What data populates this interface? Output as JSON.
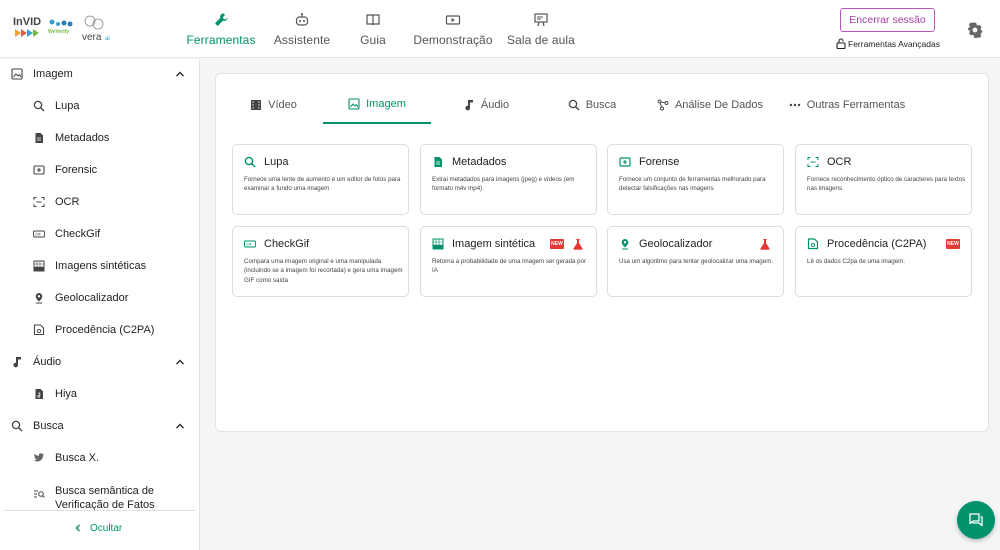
{
  "brand": {
    "invid": "InVID",
    "wevarify": "WeVerify",
    "vera": "vera",
    "vera_ai": "ai"
  },
  "nav": {
    "items": [
      {
        "label": "Ferramentas",
        "icon": "wrench-icon",
        "active": true
      },
      {
        "label": "Assistente",
        "icon": "robot-icon",
        "active": false
      },
      {
        "label": "Guia",
        "icon": "book-icon",
        "active": false
      },
      {
        "label": "Demonstração",
        "icon": "video-icon",
        "active": false
      },
      {
        "label": "Sala de aula",
        "icon": "classroom-icon",
        "active": false
      }
    ]
  },
  "header": {
    "logout_label": "Encerrar sessão",
    "advanced_label": "Ferramentas Avançadas"
  },
  "sidebar": {
    "items": [
      {
        "label": "Imagem",
        "icon": "image-icon",
        "type": "section",
        "expanded": true
      },
      {
        "label": "Lupa",
        "icon": "search-icon",
        "type": "item"
      },
      {
        "label": "Metadados",
        "icon": "document-icon",
        "type": "item"
      },
      {
        "label": "Forensic",
        "icon": "forensic-icon",
        "type": "item"
      },
      {
        "label": "OCR",
        "icon": "ocr-icon",
        "type": "item"
      },
      {
        "label": "CheckGif",
        "icon": "gif-icon",
        "type": "item"
      },
      {
        "label": "Imagens sintéticas",
        "icon": "synthetic-image-icon",
        "type": "item"
      },
      {
        "label": "Geolocalizador",
        "icon": "location-pin-icon",
        "type": "item"
      },
      {
        "label": "Procedência (C2PA)",
        "icon": "provenance-icon",
        "type": "item"
      },
      {
        "label": "Áudio",
        "icon": "music-note-icon",
        "type": "section",
        "expanded": true
      },
      {
        "label": "Hiya",
        "icon": "audio-file-icon",
        "type": "item"
      },
      {
        "label": "Busca",
        "icon": "search-icon",
        "type": "section",
        "expanded": true
      },
      {
        "label": "Busca X.",
        "icon": "x-logo-icon",
        "type": "item"
      },
      {
        "label": "Busca semântica de",
        "label2": "Verificação de Fatos",
        "icon": "semantic-search-icon",
        "type": "item"
      }
    ],
    "collapse_label": "Ocultar"
  },
  "tabs": [
    {
      "label": "Vídeo",
      "icon": "film-icon",
      "active": false
    },
    {
      "label": "Imagem",
      "icon": "image-icon",
      "active": true
    },
    {
      "label": "Áudio",
      "icon": "music-note-icon",
      "active": false
    },
    {
      "label": "Busca",
      "icon": "search-icon",
      "active": false
    },
    {
      "label": "Análise De Dados",
      "icon": "data-analysis-icon",
      "active": false
    },
    {
      "label": "Outras Ferramentas",
      "icon": "more-icon",
      "active": false
    }
  ],
  "tools": [
    {
      "title": "Lupa",
      "icon": "search-icon",
      "desc": "Fornece uma lente de aumento e um editor de fotos para examinar a fundo uma imagem",
      "new": false,
      "lab": false
    },
    {
      "title": "Metadados",
      "icon": "document-icon",
      "desc": "Extrai metadados para imagens (jpeg) e vídeos (em formato m4v mp4)",
      "new": false,
      "lab": false
    },
    {
      "title": "Forense",
      "icon": "forensic-icon",
      "desc": "Fornece um conjunto de ferramentas melhorado para detectar falsificações nas imagens",
      "new": false,
      "lab": false
    },
    {
      "title": "OCR",
      "icon": "ocr-icon",
      "desc": "Fornece reconhecimento óptico de caracteres para textos nas imagens",
      "new": false,
      "lab": false
    },
    {
      "title": "CheckGif",
      "icon": "gif-icon",
      "desc": "Compara uma imagem original e uma manipulada (incluindo se a imagem foi recortada) e gera uma imagem GIF como saída",
      "new": false,
      "lab": false
    },
    {
      "title": "Imagem sintética",
      "icon": "synthetic-image-icon",
      "desc": "Retorna a probabilidade de uma imagem ser gerada por IA",
      "new": true,
      "lab": true
    },
    {
      "title": "Geolocalizador",
      "icon": "location-pin-icon",
      "desc": "Usa um algoritmo para tentar geolocalizar uma imagem.",
      "new": false,
      "lab": true
    },
    {
      "title": "Procedência (C2PA)",
      "icon": "provenance-icon",
      "desc": "Lê os dados C2pa de uma imagem.",
      "new": true,
      "lab": false
    }
  ],
  "badges": {
    "new_label": "NEW"
  },
  "colors": {
    "accent": "#00926b",
    "logout": "#a43fa4",
    "new_badge": "#e53935"
  }
}
